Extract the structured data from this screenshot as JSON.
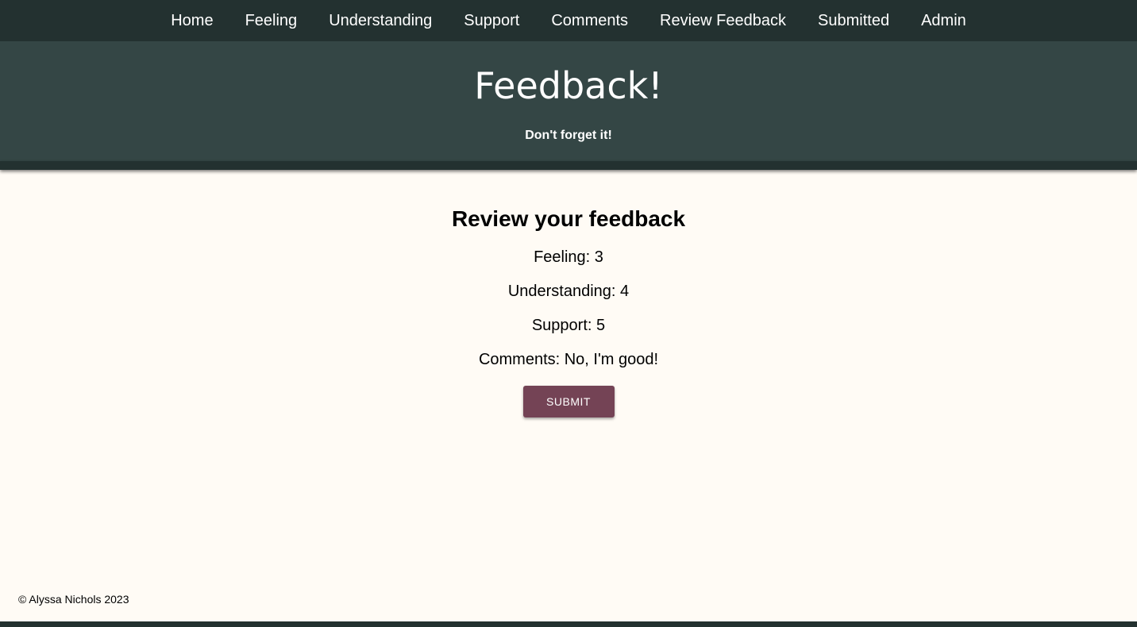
{
  "nav": {
    "items": [
      {
        "label": "Home"
      },
      {
        "label": "Feeling"
      },
      {
        "label": "Understanding"
      },
      {
        "label": "Support"
      },
      {
        "label": "Comments"
      },
      {
        "label": "Review Feedback"
      },
      {
        "label": "Submitted"
      },
      {
        "label": "Admin"
      }
    ]
  },
  "header": {
    "title": "Feedback!",
    "subtitle": "Don't forget it!"
  },
  "review": {
    "heading": "Review your feedback",
    "feeling": "Feeling: 3",
    "understanding": "Understanding: 4",
    "support": "Support: 5",
    "comments": "Comments: No, I'm good!",
    "submit_label": "Submit"
  },
  "footer": {
    "copyright": "© Alyssa Nichols 2023"
  },
  "colors": {
    "nav_bg": "#233130",
    "header_bg": "#344645",
    "page_bg": "#fffbf5",
    "button_bg": "#744355"
  }
}
